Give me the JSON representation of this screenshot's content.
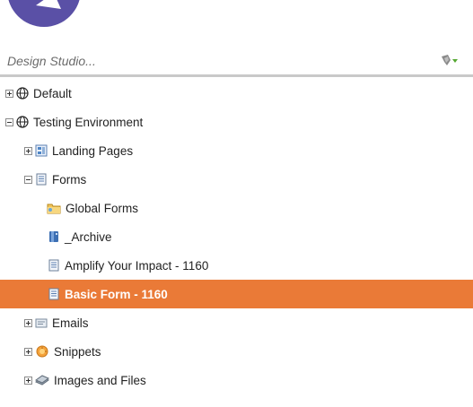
{
  "search": {
    "placeholder": "Design Studio..."
  },
  "tree": {
    "default": "Default",
    "testing_environment": "Testing Environment",
    "landing_pages": "Landing Pages",
    "forms": "Forms",
    "global_forms": "Global Forms",
    "archive": "_Archive",
    "amplify": "Amplify Your Impact - 1160",
    "basic_form": "Basic Form - 1160",
    "emails": "Emails",
    "snippets": "Snippets",
    "images_files": "Images and Files"
  },
  "colors": {
    "selected_bg": "#ea7a37",
    "logo": "#5a50a6"
  },
  "icons": {
    "logo": "marketo-logo-icon",
    "search": "filter-icon",
    "workspace": "globe-icon",
    "landing_pages": "landing-page-icon",
    "forms": "form-icon",
    "folder": "folder-icon",
    "archive": "archive-icon",
    "emails": "email-icon",
    "snippets": "snippet-icon",
    "images": "images-icon"
  }
}
